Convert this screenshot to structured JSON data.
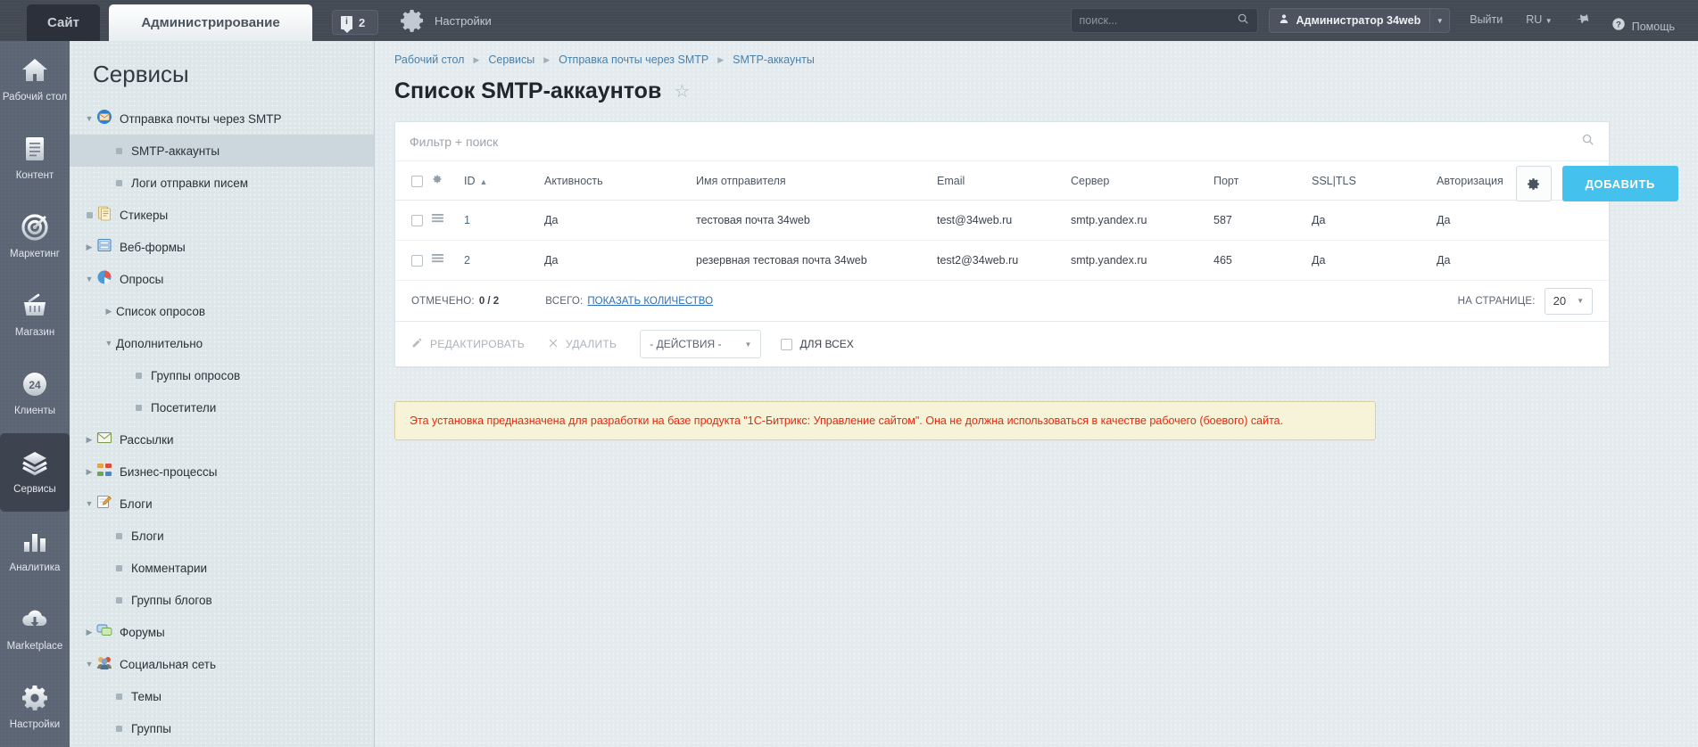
{
  "topbar": {
    "site_tab": "Сайт",
    "admin_tab": "Администрирование",
    "notifications_count": "2",
    "settings_label": "Настройки",
    "search_placeholder": "поиск...",
    "search_value": "",
    "user_name": "Администратор 34web",
    "logout_label": "Выйти",
    "lang_label": "RU",
    "help_label": "Помощь"
  },
  "rail": {
    "items": [
      {
        "label": "Рабочий стол",
        "icon": "home-icon",
        "active": false
      },
      {
        "label": "Контент",
        "icon": "document-icon",
        "active": false
      },
      {
        "label": "Маркетинг",
        "icon": "target-icon",
        "active": false
      },
      {
        "label": "Магазин",
        "icon": "basket-icon",
        "active": false
      },
      {
        "label": "Клиенты",
        "icon": "clients-24-icon",
        "active": false
      },
      {
        "label": "Сервисы",
        "icon": "layers-icon",
        "active": true
      },
      {
        "label": "Аналитика",
        "icon": "bar-chart-icon",
        "active": false
      },
      {
        "label": "Marketplace",
        "icon": "cloud-download-icon",
        "active": false
      },
      {
        "label": "Настройки",
        "icon": "gear-icon",
        "active": false
      }
    ]
  },
  "menu": {
    "title": "Сервисы",
    "items": [
      {
        "label": "Отправка почты через SMTP",
        "twist": "down",
        "icon": "mail-blue-icon",
        "indent": 0,
        "selected": false
      },
      {
        "label": "SMTP-аккаунты",
        "twist": "",
        "icon": "bullet",
        "indent": 1,
        "selected": true
      },
      {
        "label": "Логи отправки писем",
        "twist": "",
        "icon": "bullet",
        "indent": 1,
        "selected": false
      },
      {
        "label": "Стикеры",
        "twist": "bullet",
        "icon": "sticker-icon",
        "indent": 0,
        "selected": false
      },
      {
        "label": "Веб-формы",
        "twist": "right",
        "icon": "webform-icon",
        "indent": 0,
        "selected": false
      },
      {
        "label": "Опросы",
        "twist": "down",
        "icon": "poll-icon",
        "indent": 0,
        "selected": false
      },
      {
        "label": "Список опросов",
        "twist": "right",
        "icon": "none",
        "indent": 1,
        "selected": false
      },
      {
        "label": "Дополнительно",
        "twist": "down",
        "icon": "none",
        "indent": 1,
        "selected": false
      },
      {
        "label": "Группы опросов",
        "twist": "",
        "icon": "bullet",
        "indent": 2,
        "selected": false
      },
      {
        "label": "Посетители",
        "twist": "",
        "icon": "bullet",
        "indent": 2,
        "selected": false
      },
      {
        "label": "Рассылки",
        "twist": "right",
        "icon": "newsletter-icon",
        "indent": 0,
        "selected": false
      },
      {
        "label": "Бизнес-процессы",
        "twist": "right",
        "icon": "bizproc-icon",
        "indent": 0,
        "selected": false
      },
      {
        "label": "Блоги",
        "twist": "down",
        "icon": "blog-icon",
        "indent": 0,
        "selected": false
      },
      {
        "label": "Блоги",
        "twist": "",
        "icon": "bullet",
        "indent": 1,
        "selected": false
      },
      {
        "label": "Комментарии",
        "twist": "",
        "icon": "bullet",
        "indent": 1,
        "selected": false
      },
      {
        "label": "Группы блогов",
        "twist": "",
        "icon": "bullet",
        "indent": 1,
        "selected": false
      },
      {
        "label": "Форумы",
        "twist": "right",
        "icon": "forum-icon",
        "indent": 0,
        "selected": false
      },
      {
        "label": "Социальная сеть",
        "twist": "down",
        "icon": "socnet-icon",
        "indent": 0,
        "selected": false
      },
      {
        "label": "Темы",
        "twist": "",
        "icon": "bullet",
        "indent": 1,
        "selected": false
      },
      {
        "label": "Группы",
        "twist": "",
        "icon": "bullet",
        "indent": 1,
        "selected": false
      }
    ]
  },
  "breadcrumb": {
    "items": [
      "Рабочий стол",
      "Сервисы",
      "Отправка почты через SMTP",
      "SMTP-аккаунты"
    ]
  },
  "page": {
    "title": "Список SMTP-аккаунтов",
    "filter_placeholder": "Фильтр + поиск",
    "filter_value": "",
    "add_button": "ДОБАВИТЬ"
  },
  "table": {
    "columns": [
      "ID",
      "Активность",
      "Имя отправителя",
      "Email",
      "Сервер",
      "Порт",
      "SSL|TLS",
      "Авторизация"
    ],
    "sort_column": "ID",
    "sort_direction": "asc",
    "rows": [
      {
        "id": "1",
        "active": "Да",
        "sender_name": "тестовая почта 34web",
        "email": "test@34web.ru",
        "server": "smtp.yandex.ru",
        "port": "587",
        "ssl": "Да",
        "auth": "Да"
      },
      {
        "id": "2",
        "active": "Да",
        "sender_name": "резервная тестовая почта 34web",
        "email": "test2@34web.ru",
        "server": "smtp.yandex.ru",
        "port": "465",
        "ssl": "Да",
        "auth": "Да"
      }
    ]
  },
  "footer": {
    "checked_label": "ОТМЕЧЕНО:",
    "checked_value": "0 / 2",
    "total_label": "ВСЕГО:",
    "total_link": "ПОКАЗАТЬ КОЛИЧЕСТВО",
    "perpage_label": "НА СТРАНИЦЕ:",
    "perpage_value": "20"
  },
  "actions": {
    "edit": "РЕДАКТИРОВАТЬ",
    "delete": "УДАЛИТЬ",
    "select": "- ДЕЙСТВИЯ -",
    "forall": "ДЛЯ ВСЕХ"
  },
  "notice": {
    "text": "Эта установка предназначена для разработки на базе продукта \"1С-Битрикс: Управление сайтом\". Она не должна использоваться в качестве рабочего (боевого) сайта."
  },
  "colors": {
    "accent": "#45c1ee",
    "topbar": "#434a54",
    "rail": "#5b6573",
    "menu_bg": "#dde6e9",
    "notice_bg": "#f7f3d8",
    "notice_text": "#e02b12",
    "link": "#3b6e9c"
  }
}
